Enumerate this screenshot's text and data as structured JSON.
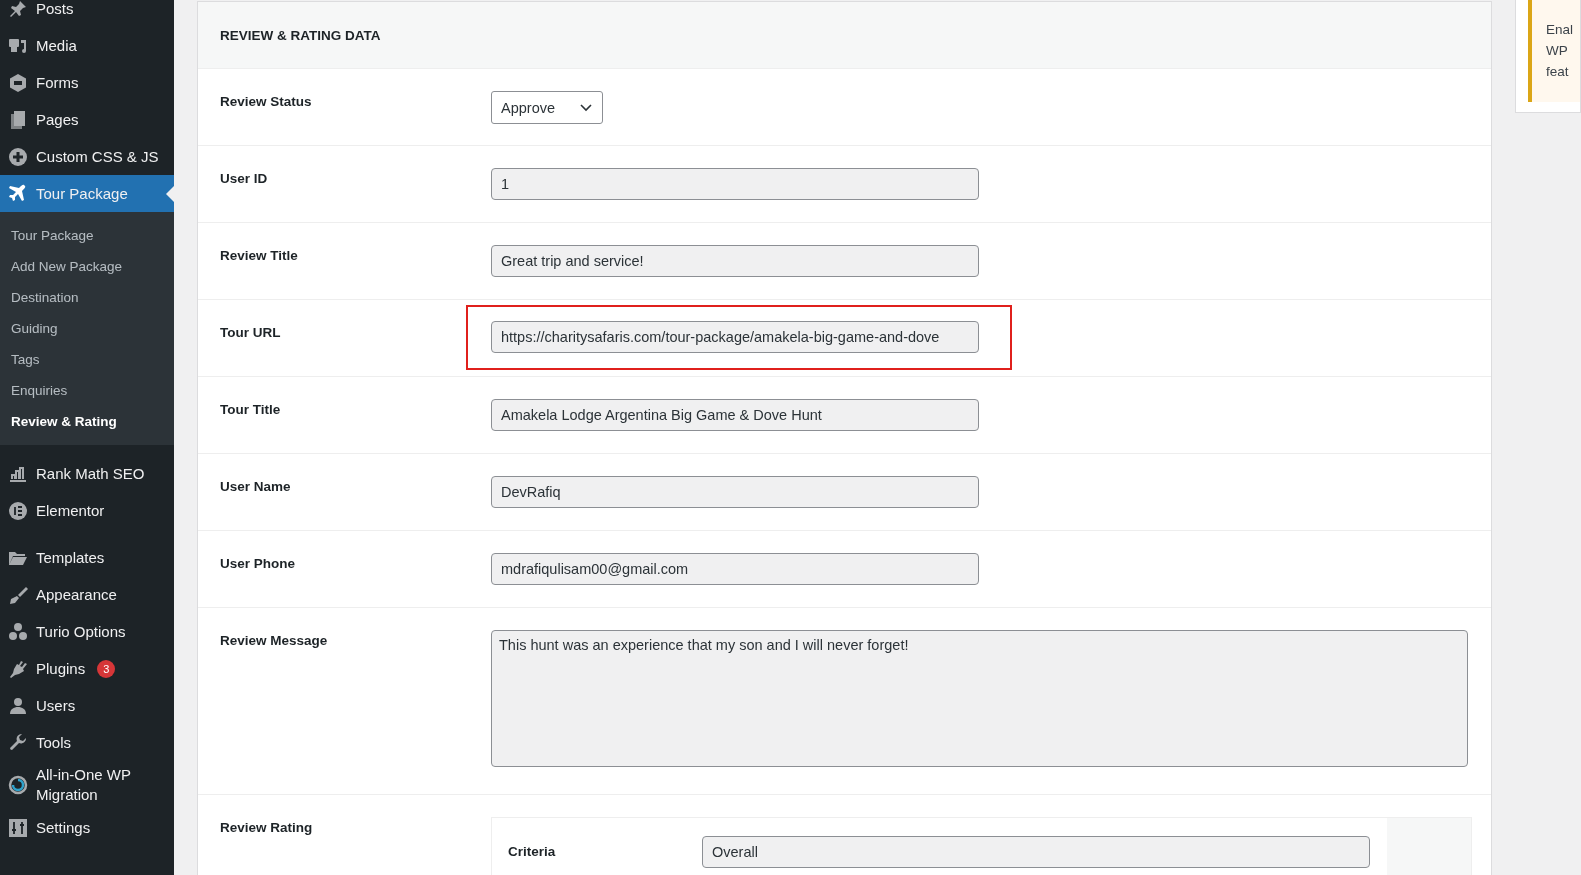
{
  "sidebar": {
    "items": [
      {
        "label": "Posts",
        "selected": false
      },
      {
        "label": "Media",
        "selected": false
      },
      {
        "label": "Forms",
        "selected": false
      },
      {
        "label": "Pages",
        "selected": false
      },
      {
        "label": "Custom CSS & JS",
        "selected": false
      },
      {
        "label": "Tour Package",
        "selected": true,
        "children": [
          {
            "label": "Tour Package",
            "selected": false
          },
          {
            "label": "Add New Package",
            "selected": false
          },
          {
            "label": "Destination",
            "selected": false
          },
          {
            "label": "Guiding",
            "selected": false
          },
          {
            "label": "Tags",
            "selected": false
          },
          {
            "label": "Enquiries",
            "selected": false
          },
          {
            "label": "Review & Rating",
            "selected": true
          }
        ]
      },
      {
        "label": "Rank Math SEO",
        "selected": false
      },
      {
        "label": "Elementor",
        "selected": false
      },
      {
        "label": "Templates",
        "selected": false
      },
      {
        "label": "Appearance",
        "selected": false
      },
      {
        "label": "Turio Options",
        "selected": false
      },
      {
        "label": "Plugins",
        "selected": false,
        "badge": "3"
      },
      {
        "label": "Users",
        "selected": false
      },
      {
        "label": "Tools",
        "selected": false
      },
      {
        "label": "All-in-One WP Migration",
        "selected": false
      },
      {
        "label": "Settings",
        "selected": false
      }
    ]
  },
  "panel": {
    "title": "REVIEW & RATING DATA",
    "fields": [
      {
        "kind": "select",
        "label": "Review Status",
        "value": "Approve"
      },
      {
        "kind": "text",
        "label": "User ID",
        "value": "1"
      },
      {
        "kind": "text",
        "label": "Review Title",
        "value": "Great trip and service!"
      },
      {
        "kind": "text",
        "label": "Tour URL",
        "value": "https://charitysafaris.com/tour-package/amakela-big-game-and-dove",
        "highlighted": true
      },
      {
        "kind": "text",
        "label": "Tour Title",
        "value": "Amakela Lodge Argentina Big Game & Dove Hunt"
      },
      {
        "kind": "text",
        "label": "User Name",
        "value": "DevRafiq"
      },
      {
        "kind": "text",
        "label": "User Phone",
        "value": "mdrafiqulisam00@gmail.com"
      },
      {
        "kind": "textarea",
        "label": "Review Message",
        "value": "This hunt was an experience that my son and I will never forget!"
      },
      {
        "kind": "rating",
        "label": "Review Rating",
        "criteria_label": "Criteria",
        "criteria_value": "Overall"
      }
    ]
  },
  "notice": {
    "lines": [
      "Enal",
      "WP",
      "feat"
    ]
  }
}
